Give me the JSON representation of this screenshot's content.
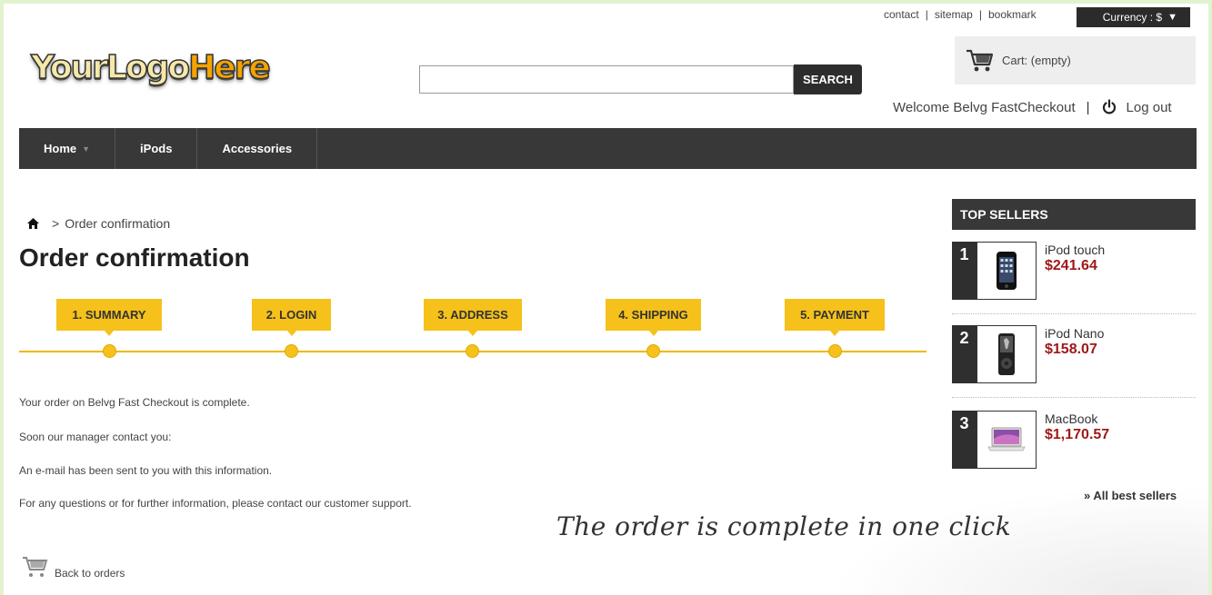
{
  "top_links": {
    "contact": "contact",
    "sitemap": "sitemap",
    "bookmark": "bookmark",
    "separator": "|"
  },
  "currency": {
    "label": "Currency : $",
    "arrow": "▼"
  },
  "logo": {
    "part1": "YourLogo",
    "part2": "Here"
  },
  "search": {
    "value": "",
    "button_label": "SEARCH"
  },
  "cart": {
    "label": "Cart: (empty)",
    "icon": "cart-icon"
  },
  "user": {
    "welcome": "Welcome Belvg FastCheckout",
    "separator": "|",
    "logout_label": "Log out",
    "logout_icon": "power-icon"
  },
  "nav": {
    "items": [
      {
        "label": "Home",
        "has_dropdown": true
      },
      {
        "label": "iPods"
      },
      {
        "label": "Accessories"
      }
    ]
  },
  "breadcrumb": {
    "home_icon": "home-icon",
    "separator": ">",
    "current": "Order confirmation"
  },
  "page_title": "Order confirmation",
  "steps": [
    "1. SUMMARY",
    "2. LOGIN",
    "3. ADDRESS",
    "4. SHIPPING",
    "5. PAYMENT"
  ],
  "messages": [
    "Your order on Belvg Fast Checkout is complete.",
    "Soon our manager contact you:",
    "An e-mail has been sent to you with this information.",
    "For any questions or for further information, please contact our customer support."
  ],
  "annotation": "The order is complete in one click",
  "back_to_orders": "Back to orders",
  "top_sellers": {
    "title": "TOP SELLERS",
    "items": [
      {
        "rank": "1",
        "name": "iPod touch",
        "price": "$241.64"
      },
      {
        "rank": "2",
        "name": "iPod Nano",
        "price": "$158.07"
      },
      {
        "rank": "3",
        "name": "MacBook",
        "price": "$1,170.57"
      }
    ],
    "all_link": "» All best sellers"
  },
  "colors": {
    "frame": "#e2f3cf",
    "nav_bg": "#383838",
    "step_yellow": "#f5c11a",
    "price_red": "#a01818"
  }
}
